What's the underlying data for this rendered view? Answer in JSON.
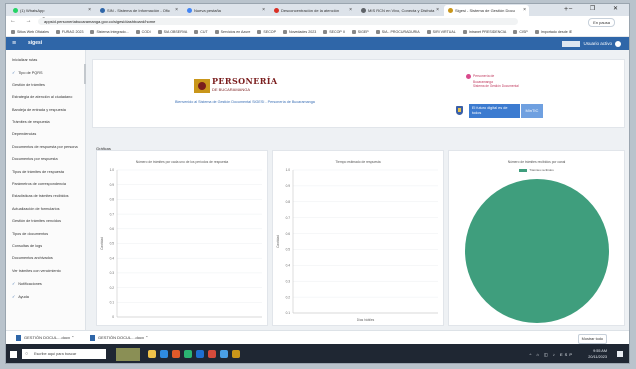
{
  "browser": {
    "tabs": [
      {
        "label": "(1) WhatsApp",
        "color": "#25d366",
        "active": false
      },
      {
        "label": "SIN - Sistema de Información - Ofic",
        "color": "#2f66a8",
        "active": false
      },
      {
        "label": "Nueva pestaña",
        "color": "#4285f4",
        "active": false
      },
      {
        "label": "Desconcentración de la atención",
        "color": "#d93025",
        "active": false
      },
      {
        "label": "MIS RCN en Vivo, Conecta y Disfruta",
        "color": "#5f6368",
        "active": false
      },
      {
        "label": "Sigesi - Sistema de Gestión Docu",
        "color": "#c9961a",
        "active": true
      }
    ],
    "new_tab": "+",
    "window_controls": "– ❐ ✕",
    "nav_icons": "← → C",
    "url": "appsid.personeriabucaramanga.gov.co/sigesi/dashboard/home",
    "profile_label": "En pausa",
    "bookmarks": [
      "Sitios Web Oficiales",
      "FURAG 2023",
      "Sistema Integrado...",
      "CODI",
      "SIA OBSERVA",
      "CUT",
      "Servicios en Azure",
      "SECOP",
      "Novedades 2023",
      "SECOP II",
      "SIGEP",
      "SIA - PROCURADURIA",
      "SIRI VIRTUAL",
      "Intranet PRESIDENCIA",
      "CISP",
      "Importado desde IE"
    ]
  },
  "app": {
    "menu_icon": "≡",
    "brand": "sigesi",
    "user": "Usuario activo"
  },
  "sidebar": {
    "items": [
      {
        "label": "Inicializar rutas",
        "check": false
      },
      {
        "label": "Tipo de PQRS",
        "check": true
      },
      {
        "label": "Gestión de trámites",
        "check": false
      },
      {
        "label": "Estrategia de atención al ciudadano",
        "check": false
      },
      {
        "label": "Bandeja de entrada y respuesta",
        "check": false
      },
      {
        "label": "Trámites de respuesta",
        "check": false
      },
      {
        "label": "Dependencias",
        "check": false
      },
      {
        "label": "Documentos de respuesta por persona",
        "check": false
      },
      {
        "label": "Documentos por respuesta",
        "check": false
      },
      {
        "label": "Tipos de trámites de respuesta",
        "check": false
      },
      {
        "label": "Parámetros de correspondencia",
        "check": false
      },
      {
        "label": "Estadísticas de trámites recibidos",
        "check": false
      },
      {
        "label": "Actualización de formularios",
        "check": false
      },
      {
        "label": "Gestión de trámites vencidos",
        "check": false
      },
      {
        "label": "Tipos de documentos",
        "check": false
      },
      {
        "label": "Consultas de logs",
        "check": false
      },
      {
        "label": "Documentos archivados",
        "check": false
      },
      {
        "label": "Ver trámites con vencimiento",
        "check": false
      },
      {
        "label": "Notificaciones",
        "check": true
      },
      {
        "label": "Ayuda",
        "check": true
      }
    ]
  },
  "banner": {
    "org_name": "PERSONERÍA",
    "org_sub": "DE BUCARAMANGA",
    "notice": "Bienvenido al Sistema de Gestión Documental SIGESI - Personería de Bucaramanga",
    "notice2_title": "Personería de",
    "notice2_lines": "Bucaramanga\nSistema de Gestión Documental",
    "btn_primary": "El futuro digital es de todos",
    "btn_secondary": "MinTIC"
  },
  "panel_title": "Gráficas",
  "charts": [
    {
      "title": "Número de trámites por cada uno de los períodos de respuesta",
      "yticks": [
        "1.0",
        "0.9",
        "0.8",
        "0.7",
        "0.6",
        "0.5",
        "0.4",
        "0.3",
        "0.2",
        "0.1",
        "0"
      ],
      "ylabel": "Cantidad"
    },
    {
      "title": "Tiempo estimado de respuesta",
      "yticks": [
        "1.0",
        "0.9",
        "0.8",
        "0.7",
        "0.6",
        "0.5",
        "0.4",
        "0.3",
        "0.2",
        "0.1"
      ],
      "ylabel": "Cantidad",
      "xlabel": "Días hábiles"
    },
    {
      "title": "Número de trámites recibidos por canal",
      "legend": "Trámites recibidos"
    }
  ],
  "chart_data": [
    {
      "type": "bar",
      "title": "Número de trámites por cada uno de los períodos de respuesta",
      "categories": [],
      "values": [],
      "ylabel": "Cantidad",
      "ylim": [
        0,
        1
      ]
    },
    {
      "type": "bar",
      "title": "Tiempo estimado de respuesta",
      "categories": [],
      "values": [],
      "xlabel": "Días hábiles",
      "ylabel": "Cantidad",
      "ylim": [
        0.1,
        1
      ]
    },
    {
      "type": "pie",
      "title": "Número de trámites recibidos por canal",
      "labels": [
        "Trámites recibidos"
      ],
      "values": [
        100
      ],
      "colors": [
        "#3f9e7d"
      ]
    }
  ],
  "downloads": {
    "items": [
      "GESTIÓN DOCUL....docx",
      "GESTIÓN DOCUL....docx"
    ],
    "show_all": "Mostrar todo"
  },
  "taskbar": {
    "search_placeholder": "Escribe aquí para buscar",
    "time": "9:55 AM",
    "date": "20/11/2023",
    "tray": "^ ⌂ ◫ ♪ ESP",
    "app_colors": [
      "#f0c34a",
      "#2f8be0",
      "#e15a2a",
      "#2bb673",
      "#1f6fd1",
      "#d64b3c",
      "#4aa0e6",
      "#c9961a"
    ]
  }
}
